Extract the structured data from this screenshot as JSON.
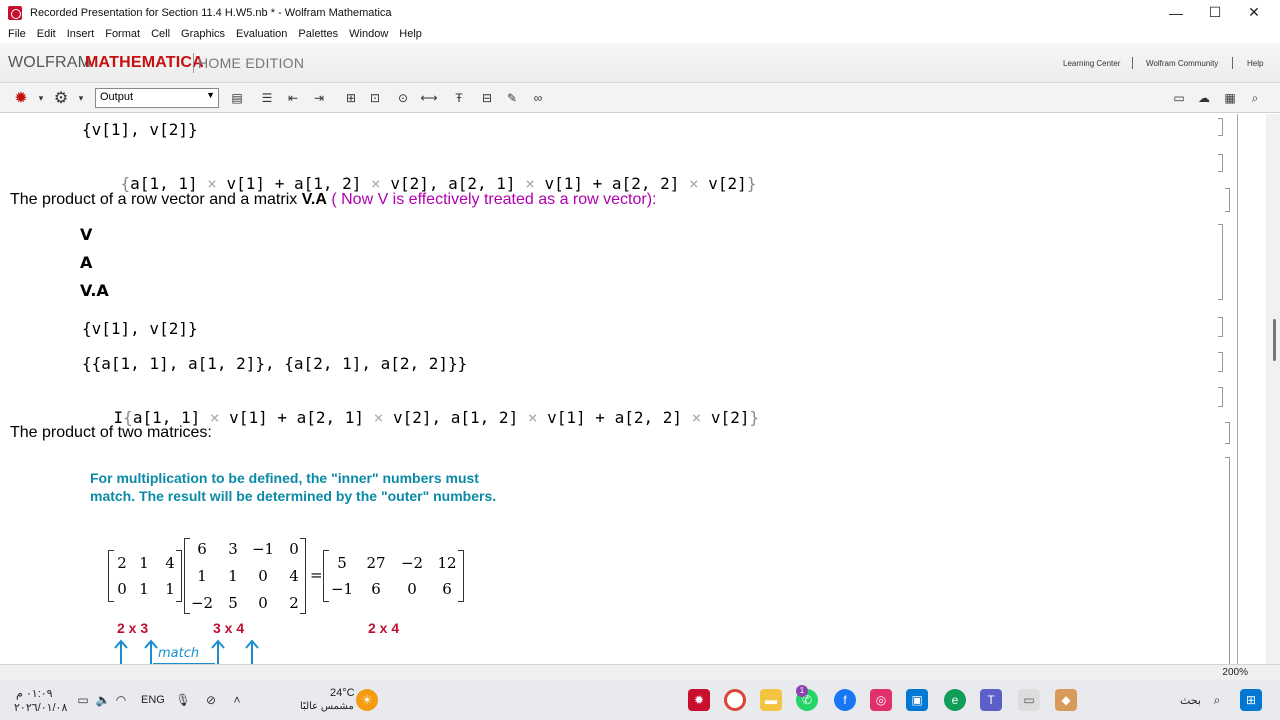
{
  "window": {
    "title": "Recorded Presentation for Section 11.4 H.W5.nb * - Wolfram Mathematica",
    "minimize": "—",
    "maximize": "☐",
    "close": "✕"
  },
  "menu": [
    "File",
    "Edit",
    "Insert",
    "Format",
    "Cell",
    "Graphics",
    "Evaluation",
    "Palettes",
    "Window",
    "Help"
  ],
  "brand": {
    "wolfram": "WOLFRAM",
    "mathematica": "MATHEMATICA",
    "edition": "HOME EDITION",
    "links": [
      "Learning Center",
      "Wolfram Community",
      "Help"
    ]
  },
  "toolbar": {
    "style_value": "Output"
  },
  "notebook": {
    "line1": "{v[1], v[2]}",
    "line2_parts": [
      "a[1, 1]",
      "v[1]",
      "a[1, 2]",
      "v[2]",
      "a[2, 1]",
      "v[1]",
      "a[2, 2]",
      "v[2]"
    ],
    "heading1_black": "The product of a row vector and a matrix ",
    "heading1_bold": "V.A",
    "heading1_magenta": " ( Now V is effectively treated as a row vector):",
    "input_v": "V",
    "input_a": "A",
    "input_va": "V.A",
    "out_v": "{v[1], v[2]}",
    "out_a": "{{a[1, 1], a[1, 2]}, {a[2, 1], a[2, 2]}}",
    "out_va_parts": [
      "a[1, 1]",
      "v[1]",
      "a[2, 1]",
      "v[2]",
      "a[1, 2]",
      "v[1]",
      "a[2, 2]",
      "v[2]"
    ],
    "heading2": "The product of two matrices:",
    "note": "For multiplication to be defined, the \"inner\" numbers must match. The result will be determined by the \"outer\" numbers.",
    "matrix_a": [
      [
        "2",
        "1",
        "4"
      ],
      [
        "0",
        "1",
        "1"
      ]
    ],
    "matrix_b": [
      [
        "6",
        "3",
        "−1",
        "0"
      ],
      [
        "1",
        "1",
        "0",
        "4"
      ],
      [
        "−2",
        "5",
        "0",
        "2"
      ]
    ],
    "matrix_c": [
      [
        "5",
        "27",
        "−2",
        "12"
      ],
      [
        "−1",
        "6",
        "0",
        "6"
      ]
    ],
    "equals": "=",
    "dim_a": "2 x 3",
    "dim_b": "3 x 4",
    "dim_c": "2 x 4",
    "match_label": "match"
  },
  "status": {
    "zoom": "200%"
  },
  "taskbar": {
    "time": "٠١:٠٩ م",
    "date": "٢٠٢٦/٠١/٠٨",
    "lang": "ENG",
    "temp": "24°C",
    "weather": "مشمس عالبًا",
    "search": "بحث",
    "notif_badge": "1"
  },
  "colors": {
    "brand_red": "#c41010",
    "magenta": "#b000b0",
    "note_teal": "#0b8aa8",
    "dim_red": "#c01030"
  }
}
